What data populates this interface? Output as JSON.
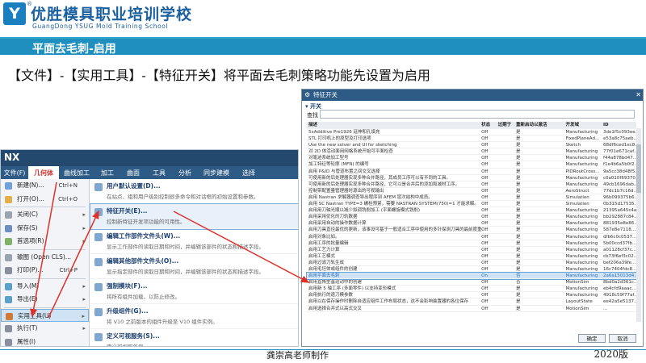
{
  "header": {
    "logo_letter": "Y",
    "logo_cn": "优胜模具职业培训学校",
    "logo_en": "GuangDong YSUG Mold Training School",
    "reg_mark": "®"
  },
  "banner": {
    "title": "平面去毛刺-启用"
  },
  "instruction": "【文件】-【实用工具】-【特征开关】将平面去毛刺策略功能先设置为启用",
  "nx": {
    "logo": "NX",
    "menubar": [
      "文件(F)",
      "几何体",
      "曲线加工",
      "加工",
      "曲面",
      "工具",
      "分析",
      "同步建模",
      "选择"
    ],
    "left_items": [
      {
        "label": "新建(N)...",
        "shortcut": "Ctrl+N",
        "arrow": ""
      },
      {
        "label": "打开(O)...",
        "shortcut": "Ctrl+O",
        "arrow": ""
      },
      {
        "label": "关闭(C)",
        "shortcut": "",
        "arrow": "▸"
      },
      {
        "label": "保存(S)",
        "shortcut": "",
        "arrow": "▸"
      },
      {
        "label": "首选项(R)",
        "shortcut": "",
        "arrow": "▸"
      },
      {
        "label": "输图 (Open CLS)...",
        "shortcut": "",
        "arrow": ""
      },
      {
        "label": "打印(P)...",
        "shortcut": "Ctrl+P",
        "arrow": ""
      },
      {
        "label": "导入(M)",
        "shortcut": "",
        "arrow": "▸"
      },
      {
        "label": "导出(E)",
        "shortcut": "",
        "arrow": "▸"
      },
      {
        "label": "实用工具(U)",
        "shortcut": "",
        "arrow": "▸"
      },
      {
        "label": "执行(T)",
        "shortcut": "",
        "arrow": "▸"
      },
      {
        "label": "属性(I)",
        "shortcut": "",
        "arrow": ""
      }
    ],
    "sub_items": [
      {
        "title": "用户默认设置(D)...",
        "desc": "在站点、组和用户级别控制很多命令和对话框的初始设置和参数。"
      },
      {
        "title": "特征开关(E)...",
        "desc": "控制新特征开发项功能的可用性。"
      },
      {
        "title": "编辑工作部件文件头(W)...",
        "desc": "显示工作部件的读取日期和时间，并编辑该部件的状态和描述字段。"
      },
      {
        "title": "编辑其他部件文件头(O)...",
        "desc": "显示指定部件的读取日期和时间，并编辑该部件的状态和描述字段。"
      },
      {
        "title": "强制模块(F)...",
        "desc": "将所有组件加载，以防止修改。"
      },
      {
        "title": "升级组件(G)...",
        "desc": "将 V10 之前版本的组件升级至 V10 组件实例。"
      },
      {
        "title": "定义可视服务(S)...",
        "desc": "定义可视服务器。"
      }
    ]
  },
  "dialog": {
    "title": "特征开关",
    "section": "▾ 开关",
    "search_label": "查找",
    "columns": [
      "描述",
      "状态",
      "过期于",
      "重新启动以激活",
      "开发域",
      "ID"
    ],
    "rows": [
      [
        "5xAdditive Pre1926 延伸和孔填充",
        "Off",
        "",
        "是",
        "Manufacturing",
        "3de1f5c093ee…"
      ],
      [
        "STL 打印机上的原型及打印选项",
        "Off",
        "",
        "是",
        "FixedPlaneAd…",
        "e53a8c75aeb…"
      ],
      [
        "Use the new solver and UI for sketching",
        "Off",
        "",
        "是",
        "Sketch",
        "68df6ced1ec8…"
      ],
      [
        "对 2D 体活动面用网格系统开始可平面检查",
        "Off",
        "",
        "是",
        "Manufacturing",
        "77f01e671caf…"
      ],
      [
        "对笔迹系统加工型号",
        "Off",
        "",
        "是",
        "Manufacturing",
        "f44a878bd47…"
      ],
      [
        "加工特征等轮廓 (MFN) 的编号",
        "Off",
        "",
        "是",
        "Manufacturing",
        "f1e4b6a5b0f2…"
      ],
      [
        "启用 P&ID 与管道布置之间交叉选择",
        "Off",
        "",
        "是",
        "PIDRoutCross…",
        "9a5cc38d48f5…"
      ],
      [
        "可使用新的后处理器实现多种合并路径，其成员工序可以有不同的工具。",
        "Off",
        "",
        "是",
        "Manufacturing",
        "c0a010f69370…"
      ],
      [
        "可使用新的后处理器实现多种合并路径，它可以是合并后的添加和减材工序。",
        "Off",
        "",
        "是",
        "Manufacturing",
        "49cb1696dab…"
      ],
      [
        "控制带配置量管理器时源出的可视输出",
        "Off",
        "",
        "是",
        "AeroStruct",
        "77dc1b7c16d…"
      ],
      [
        "启用 Nastran 求解器调查导出程序到 AFEM 层次结构中成员。",
        "Off",
        "",
        "是",
        "Simulation",
        "96b099375b6…"
      ],
      [
        "启用 SC Nastran TYPE=3 螺栓预紧，需要 NASTRAN SYSTEM(750)=1 才能求解。",
        "Off",
        "",
        "是",
        "Simulation",
        "0b315d17535…"
      ],
      [
        "启用用刀轴光顺以减少拟调铣削加工 (平面螺旋模式铣削)",
        "Off",
        "",
        "是",
        "Manufacturing",
        "21395a645c4a…"
      ],
      [
        "启用采用优化的刀轨数据",
        "Off",
        "",
        "是",
        "Manufacturing",
        "bb292887c84…"
      ],
      [
        "启用采用自动的操作数据计算",
        "Off",
        "",
        "是",
        "Manufacturing",
        "881935e8e86…"
      ],
      [
        "启用刀具直径最优的更新，该事设可基于一般适合工序中使用的多针探测刀具的最前度重组。",
        "Off",
        "",
        "是",
        "Manufacturing",
        "587e8e7118…"
      ],
      [
        "启用对象比如。",
        "Off",
        "",
        "是",
        "Manufacturing",
        "dfb6c0c0537…"
      ],
      [
        "启用工序的批量编辑",
        "Off",
        "",
        "是",
        "Manufacturing",
        "5b00ccd37fb…"
      ],
      [
        "启用工艺力计算",
        "Off",
        "",
        "是",
        "Manufacturing",
        "a01128cf37c…"
      ],
      [
        "启用工艺模式",
        "Off",
        "",
        "是",
        "Manufacturing",
        "cb73f6ef3c02…"
      ],
      [
        "启用过滤刀轨生成",
        "Off",
        "",
        "是",
        "Manufacturing",
        "bef206a39fe…"
      ],
      [
        "启用毛坯体或组件的创建",
        "Off",
        "",
        "是",
        "Manufacturing",
        "16c7404fdc8…"
      ],
      [
        "启用平面去毛刺",
        "On",
        "",
        "否",
        "Manufacturing",
        "2a6a15013d4…"
      ],
      [
        "启用直角型基运动中的创建",
        "Off",
        "",
        "否",
        "MotionSim",
        "8bd0a2d361c…"
      ],
      [
        "启用新 5 轴工序 (多面零件) 以支持变形模式",
        "Off",
        "",
        "是",
        "Manufacturing",
        "eb4cfd9aaac…"
      ],
      [
        "启用执行的退刀模参数",
        "Off",
        "",
        "是",
        "Manufacturing",
        "4918c59f77af…"
      ],
      [
        "启用以在保存操作时删除自适应组件工作布局状态，这不会影响装置器的各位保存",
        "Off",
        "",
        "是",
        "LayoutState",
        "ee42a5e5137…"
      ],
      [
        "启用选择合并式以高式交叉",
        "Off",
        "",
        "是",
        "MotionSim",
        "…"
      ]
    ],
    "highlight_row": 22,
    "ok_label": "确定",
    "cancel_label": "取消"
  },
  "footer": {
    "author": "龚崇高老师制作",
    "version": "2020版"
  },
  "colors": {
    "banner": "#1e8fbf",
    "nx_bar": "#234a6e",
    "arrow": "#e0302a",
    "highlight": "#cfe3f5"
  }
}
